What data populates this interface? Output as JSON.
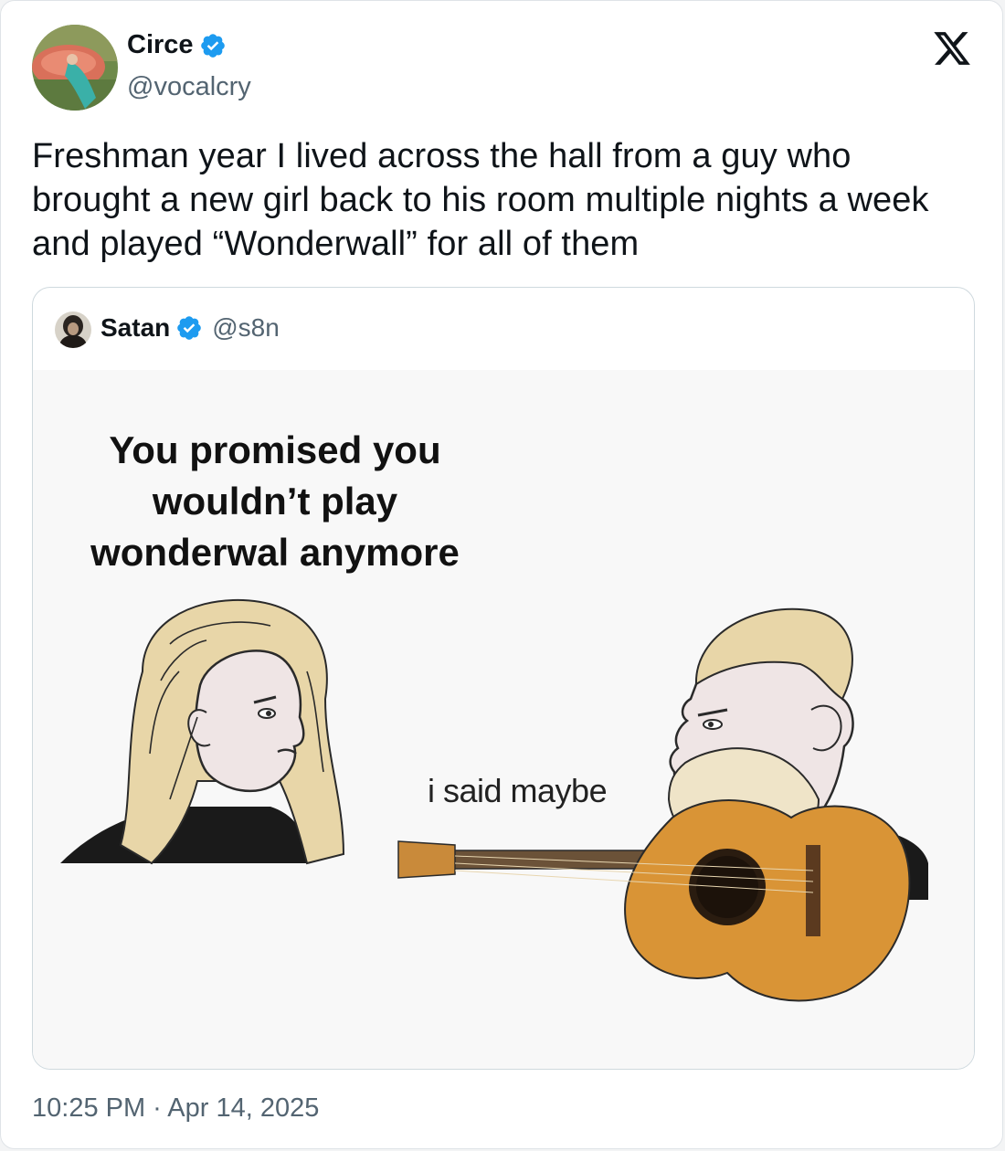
{
  "author": {
    "name": "Circe",
    "handle": "@vocalcry",
    "verified": true
  },
  "tweet": {
    "lines": [
      "Freshman year I lived across the hall from a guy who",
      "brought a new girl back to his room multiple nights a week",
      "and played “Wonderwall” for all of them"
    ]
  },
  "quoted": {
    "author": {
      "name": "Satan",
      "handle": "@s8n",
      "verified": true
    },
    "meme": {
      "caption_lines": [
        "You promised you",
        "wouldn’t play",
        "wonderwal anymore"
      ],
      "reply": "i said maybe"
    }
  },
  "timestamp": "10:25 PM · Apr 14, 2025",
  "icons": {
    "logo": "x-logo-icon",
    "verified": "verified-badge-icon"
  },
  "colors": {
    "verified_blue": "#1d9bf0",
    "text": "#0f1419",
    "muted": "#536471"
  }
}
